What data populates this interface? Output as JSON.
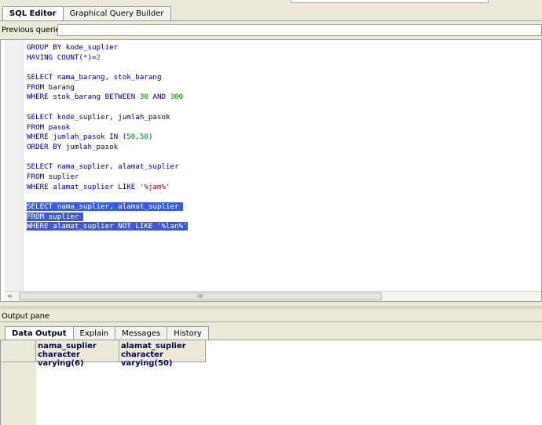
{
  "editor_tabs": [
    {
      "label": "SQL Editor",
      "active": true
    },
    {
      "label": "Graphical Query Builder",
      "active": false
    }
  ],
  "previous_queries": {
    "label": "Previous queries",
    "value": ""
  },
  "sql_lines": [
    [
      {
        "t": "GROUP BY kode_suplier"
      }
    ],
    [
      {
        "t": "HAVING COUNT(*)="
      },
      {
        "t": "2",
        "c": "num"
      }
    ],
    [
      {
        "t": ""
      }
    ],
    [
      {
        "t": "SELECT nama_barang, stok_barang"
      }
    ],
    [
      {
        "t": "FROM barang"
      }
    ],
    [
      {
        "t": "WHERE stok_barang BETWEEN "
      },
      {
        "t": "30",
        "c": "num"
      },
      {
        "t": " AND "
      },
      {
        "t": "300",
        "c": "num"
      }
    ],
    [
      {
        "t": ""
      }
    ],
    [
      {
        "t": "SELECT kode_suplier, jumlah_pasok"
      }
    ],
    [
      {
        "t": "FROM pasok"
      }
    ],
    [
      {
        "t": "WHERE jumlah_pasok IN ("
      },
      {
        "t": "50",
        "c": "num"
      },
      {
        "t": ","
      },
      {
        "t": "50",
        "c": "num"
      },
      {
        "t": ")"
      }
    ],
    [
      {
        "t": "ORDER BY jumlah_pasok"
      }
    ],
    [
      {
        "t": ""
      }
    ],
    [
      {
        "t": "SELECT nama_suplier, alamat_suplier"
      }
    ],
    [
      {
        "t": "FROM suplier"
      }
    ],
    [
      {
        "t": "WHERE alamat_suplier LIKE "
      },
      {
        "t": "'%jam%'",
        "c": "str"
      }
    ],
    [
      {
        "t": ""
      }
    ],
    [
      {
        "t": "SELECT nama_suplier, alamat_suplier ",
        "sel": true
      }
    ],
    [
      {
        "t": "FROM suplier ",
        "sel": true
      }
    ],
    [
      {
        "t": "WHERE alamat_suplier NOT LIKE ",
        "sel": true
      },
      {
        "t": "'%lan%'",
        "c": "str",
        "sel": true
      }
    ]
  ],
  "scrollbar": {
    "left_arrow": "<",
    "thumb_grip": "III"
  },
  "output_pane": {
    "label": "Output pane"
  },
  "output_tabs": [
    {
      "label": "Data Output",
      "active": true
    },
    {
      "label": "Explain",
      "active": false
    },
    {
      "label": "Messages",
      "active": false
    },
    {
      "label": "History",
      "active": false
    }
  ],
  "columns": [
    {
      "name": "nama_suplier",
      "type": "character varying(6)"
    },
    {
      "name": "alamat_suplier",
      "type": "character varying(50)"
    }
  ],
  "colors": {
    "selection": "#3e5bd6",
    "keyword": "#00008b",
    "number": "#008000",
    "string": "#8b0000"
  }
}
